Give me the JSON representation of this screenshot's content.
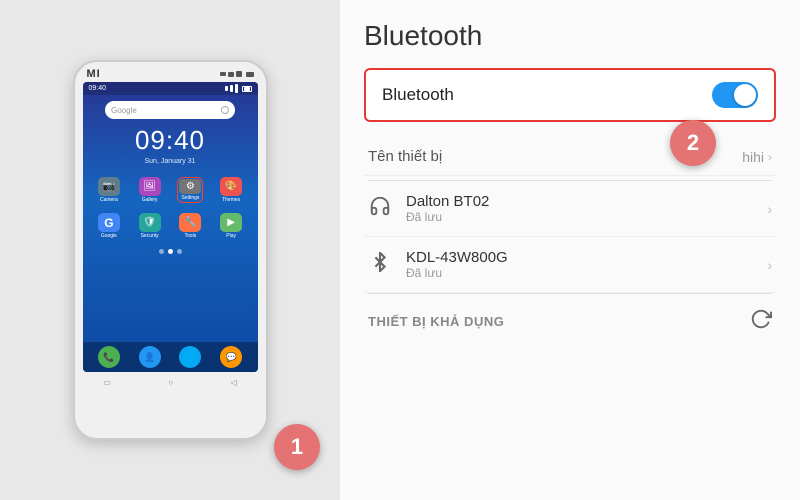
{
  "left": {
    "phone": {
      "brand": "MI",
      "time": "09:40",
      "date": "Sun, January 31",
      "search_placeholder": "Google",
      "apps_row1": [
        {
          "label": "Camera",
          "color": "#607d8b",
          "icon": "📷"
        },
        {
          "label": "Gallery",
          "color": "#ab47bc",
          "icon": "🖼"
        },
        {
          "label": "Settings",
          "color": "#757575",
          "icon": "⚙",
          "highlight": true
        },
        {
          "label": "Themes",
          "color": "#ef5350",
          "icon": "🎨"
        }
      ],
      "apps_row2": [
        {
          "label": "Google",
          "color": "#4285f4",
          "icon": "G"
        },
        {
          "label": "Security",
          "color": "#26a69a",
          "icon": "🛡"
        },
        {
          "label": "Tools",
          "color": "#ff7043",
          "icon": "🔧"
        },
        {
          "label": "Play",
          "color": "#66bb6a",
          "icon": "▶"
        }
      ],
      "dock": [
        {
          "label": "Phone",
          "color": "#4caf50",
          "icon": "📞"
        },
        {
          "label": "Contacts",
          "color": "#2196f3",
          "icon": "👤"
        },
        {
          "label": "Browser",
          "color": "#03a9f4",
          "icon": "🌐"
        },
        {
          "label": "Messaging",
          "color": "#ff9800",
          "icon": "💬"
        }
      ],
      "nav_buttons": [
        "▭",
        "○",
        "◁"
      ],
      "step_number": "1"
    }
  },
  "right": {
    "title": "Bluetooth",
    "toggle": {
      "label": "Bluetooth",
      "state": "on"
    },
    "device_name_section": {
      "label": "Tên thiết bị",
      "value": "hihi",
      "step_number": "2"
    },
    "saved_devices": [
      {
        "name": "Dalton BT02",
        "status": "Đã lưu",
        "icon": "headphones"
      },
      {
        "name": "KDL-43W800G",
        "status": "Đã lưu",
        "icon": "bluetooth"
      }
    ],
    "available_section": {
      "label": "THIẾT BỊ KHẢ DỤNG",
      "icon": "refresh"
    }
  }
}
